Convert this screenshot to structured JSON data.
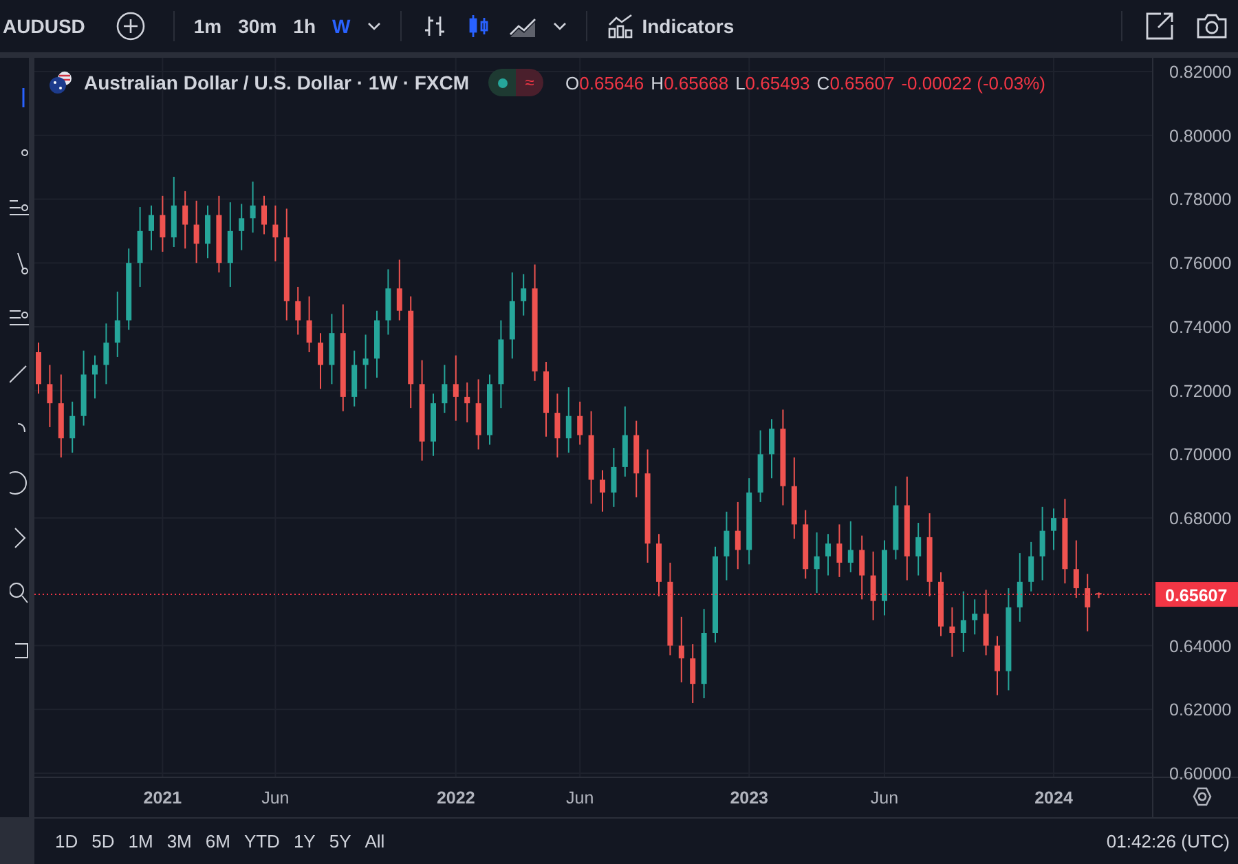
{
  "toolbar": {
    "symbol": "AUDUSD",
    "intervals": [
      {
        "label": "1m",
        "selected": false
      },
      {
        "label": "30m",
        "selected": false
      },
      {
        "label": "1h",
        "selected": false
      },
      {
        "label": "W",
        "selected": true
      }
    ],
    "chart_styles": [
      {
        "kind": "bars",
        "selected": false
      },
      {
        "kind": "candles",
        "selected": true
      },
      {
        "kind": "area",
        "selected": false
      }
    ],
    "indicators": "Indicators"
  },
  "legend": {
    "title": "Australian Dollar / U.S. Dollar · 1W · FXCM",
    "toggle_symbol": "≈",
    "ohlc": [
      {
        "label": "O",
        "value": "0.65646"
      },
      {
        "label": "H",
        "value": "0.65668"
      },
      {
        "label": "L",
        "value": "0.65493"
      },
      {
        "label": "C",
        "value": "0.65607"
      }
    ],
    "change": "-0.00022 (-0.03%)"
  },
  "chart": {
    "chart_data": {
      "type": "candlestick",
      "grid": true,
      "ref_lines": [
        {
          "axis": "y",
          "value": 0.65607,
          "label": "0.65607",
          "color": "#f23645"
        }
      ],
      "categories": [
        null,
        null,
        null,
        null,
        null,
        null,
        null,
        null,
        null,
        null,
        null,
        "2021",
        null,
        null,
        null,
        null,
        null,
        null,
        null,
        null,
        null,
        "Jun",
        null,
        null,
        null,
        null,
        null,
        null,
        null,
        null,
        null,
        null,
        null,
        null,
        null,
        null,
        null,
        "2022",
        null,
        null,
        null,
        null,
        null,
        null,
        null,
        null,
        null,
        null,
        "Jun",
        null,
        null,
        null,
        null,
        null,
        null,
        null,
        null,
        null,
        null,
        null,
        null,
        null,
        null,
        "2023",
        null,
        null,
        null,
        null,
        null,
        null,
        null,
        null,
        null,
        null,
        null,
        "Jun",
        null,
        null,
        null,
        null,
        null,
        null,
        null,
        null,
        null,
        null,
        null,
        null,
        null,
        null,
        "2024",
        null,
        null,
        null,
        null
      ],
      "ohlc": [
        [
          0.732,
          0.735,
          0.719,
          0.722
        ],
        [
          0.722,
          0.728,
          0.7085,
          0.716
        ],
        [
          0.716,
          0.725,
          0.699,
          0.705
        ],
        [
          0.705,
          0.7165,
          0.7005,
          0.712
        ],
        [
          0.712,
          0.7325,
          0.709,
          0.725
        ],
        [
          0.725,
          0.731,
          0.7175,
          0.728
        ],
        [
          0.728,
          0.741,
          0.722,
          0.735
        ],
        [
          0.735,
          0.751,
          0.7305,
          0.742
        ],
        [
          0.742,
          0.7645,
          0.739,
          0.76
        ],
        [
          0.76,
          0.7775,
          0.7525,
          0.77
        ],
        [
          0.77,
          0.778,
          0.764,
          0.775
        ],
        [
          0.775,
          0.781,
          0.7635,
          0.768
        ],
        [
          0.768,
          0.787,
          0.765,
          0.778
        ],
        [
          0.778,
          0.7825,
          0.7645,
          0.772
        ],
        [
          0.772,
          0.7795,
          0.76,
          0.766
        ],
        [
          0.766,
          0.778,
          0.7615,
          0.775
        ],
        [
          0.775,
          0.781,
          0.757,
          0.76
        ],
        [
          0.76,
          0.779,
          0.7525,
          0.77
        ],
        [
          0.77,
          0.7785,
          0.764,
          0.774
        ],
        [
          0.774,
          0.7855,
          0.7695,
          0.778
        ],
        [
          0.778,
          0.781,
          0.769,
          0.772
        ],
        [
          0.772,
          0.778,
          0.7605,
          0.768
        ],
        [
          0.768,
          0.777,
          0.742,
          0.748
        ],
        [
          0.748,
          0.7525,
          0.7375,
          0.742
        ],
        [
          0.742,
          0.7495,
          0.732,
          0.735
        ],
        [
          0.735,
          0.738,
          0.7205,
          0.728
        ],
        [
          0.728,
          0.744,
          0.722,
          0.738
        ],
        [
          0.738,
          0.747,
          0.7135,
          0.718
        ],
        [
          0.718,
          0.7325,
          0.715,
          0.728
        ],
        [
          0.728,
          0.7375,
          0.7205,
          0.73
        ],
        [
          0.73,
          0.745,
          0.724,
          0.742
        ],
        [
          0.742,
          0.758,
          0.7375,
          0.752
        ],
        [
          0.752,
          0.761,
          0.742,
          0.745
        ],
        [
          0.745,
          0.7495,
          0.7145,
          0.722
        ],
        [
          0.722,
          0.7295,
          0.698,
          0.704
        ],
        [
          0.704,
          0.719,
          0.6995,
          0.716
        ],
        [
          0.716,
          0.728,
          0.713,
          0.722
        ],
        [
          0.722,
          0.731,
          0.7105,
          0.718
        ],
        [
          0.718,
          0.7225,
          0.71,
          0.716
        ],
        [
          0.716,
          0.7235,
          0.7015,
          0.706
        ],
        [
          0.706,
          0.725,
          0.703,
          0.722
        ],
        [
          0.722,
          0.742,
          0.7145,
          0.736
        ],
        [
          0.736,
          0.757,
          0.73,
          0.748
        ],
        [
          0.748,
          0.7565,
          0.7435,
          0.752
        ],
        [
          0.752,
          0.7595,
          0.723,
          0.726
        ],
        [
          0.726,
          0.729,
          0.7055,
          0.713
        ],
        [
          0.713,
          0.719,
          0.699,
          0.705
        ],
        [
          0.705,
          0.721,
          0.7005,
          0.712
        ],
        [
          0.712,
          0.7165,
          0.703,
          0.706
        ],
        [
          0.706,
          0.7135,
          0.6845,
          0.692
        ],
        [
          0.692,
          0.695,
          0.682,
          0.688
        ],
        [
          0.688,
          0.702,
          0.6835,
          0.696
        ],
        [
          0.696,
          0.715,
          0.693,
          0.706
        ],
        [
          0.706,
          0.7105,
          0.6865,
          0.694
        ],
        [
          0.694,
          0.7015,
          0.666,
          0.672
        ],
        [
          0.672,
          0.675,
          0.6555,
          0.66
        ],
        [
          0.66,
          0.666,
          0.637,
          0.64
        ],
        [
          0.64,
          0.649,
          0.6285,
          0.636
        ],
        [
          0.636,
          0.6405,
          0.622,
          0.628
        ],
        [
          0.628,
          0.6515,
          0.6235,
          0.644
        ],
        [
          0.644,
          0.671,
          0.641,
          0.668
        ],
        [
          0.668,
          0.682,
          0.6605,
          0.676
        ],
        [
          0.676,
          0.685,
          0.664,
          0.67
        ],
        [
          0.67,
          0.6925,
          0.6655,
          0.688
        ],
        [
          0.688,
          0.7075,
          0.685,
          0.7
        ],
        [
          0.7,
          0.711,
          0.6925,
          0.708
        ],
        [
          0.708,
          0.714,
          0.684,
          0.69
        ],
        [
          0.69,
          0.699,
          0.6735,
          0.678
        ],
        [
          0.678,
          0.6825,
          0.661,
          0.664
        ],
        [
          0.664,
          0.6755,
          0.6565,
          0.668
        ],
        [
          0.668,
          0.675,
          0.662,
          0.672
        ],
        [
          0.672,
          0.678,
          0.6615,
          0.666
        ],
        [
          0.666,
          0.679,
          0.663,
          0.67
        ],
        [
          0.67,
          0.6745,
          0.6545,
          0.662
        ],
        [
          0.662,
          0.6695,
          0.648,
          0.654
        ],
        [
          0.654,
          0.673,
          0.6495,
          0.67
        ],
        [
          0.67,
          0.69,
          0.667,
          0.684
        ],
        [
          0.684,
          0.693,
          0.6605,
          0.668
        ],
        [
          0.668,
          0.6785,
          0.662,
          0.674
        ],
        [
          0.674,
          0.6815,
          0.6555,
          0.66
        ],
        [
          0.66,
          0.663,
          0.643,
          0.646
        ],
        [
          0.646,
          0.652,
          0.6365,
          0.644
        ],
        [
          0.644,
          0.657,
          0.638,
          0.648
        ],
        [
          0.648,
          0.6545,
          0.6435,
          0.65
        ],
        [
          0.65,
          0.6575,
          0.637,
          0.64
        ],
        [
          0.64,
          0.643,
          0.6245,
          0.632
        ],
        [
          0.632,
          0.658,
          0.626,
          0.652
        ],
        [
          0.652,
          0.669,
          0.6475,
          0.66
        ],
        [
          0.66,
          0.6725,
          0.657,
          0.668
        ],
        [
          0.668,
          0.6835,
          0.6605,
          0.676
        ],
        [
          0.676,
          0.683,
          0.67,
          0.68
        ],
        [
          0.68,
          0.686,
          0.6595,
          0.664
        ],
        [
          0.664,
          0.673,
          0.655,
          0.658
        ],
        [
          0.658,
          0.6625,
          0.6445,
          0.652
        ],
        [
          0.65646,
          0.65668,
          0.65493,
          0.65607
        ]
      ],
      "ylim": [
        0.6,
        0.82
      ],
      "yticks": [
        {
          "value": 0.82,
          "label": "0.82000"
        },
        {
          "value": 0.8,
          "label": "0.80000"
        },
        {
          "value": 0.78,
          "label": "0.78000"
        },
        {
          "value": 0.76,
          "label": "0.76000"
        },
        {
          "value": 0.74,
          "label": "0.74000"
        },
        {
          "value": 0.72,
          "label": "0.72000"
        },
        {
          "value": 0.7,
          "label": "0.70000"
        },
        {
          "value": 0.68,
          "label": "0.68000"
        },
        {
          "value": 0.64,
          "label": "0.64000"
        },
        {
          "value": 0.62,
          "label": "0.62000"
        },
        {
          "value": 0.6,
          "label": "0.60000"
        }
      ]
    }
  },
  "range_buttons": [
    "1D",
    "5D",
    "1M",
    "3M",
    "6M",
    "YTD",
    "1Y",
    "5Y",
    "All"
  ],
  "clock": "01:42:26 (UTC)"
}
